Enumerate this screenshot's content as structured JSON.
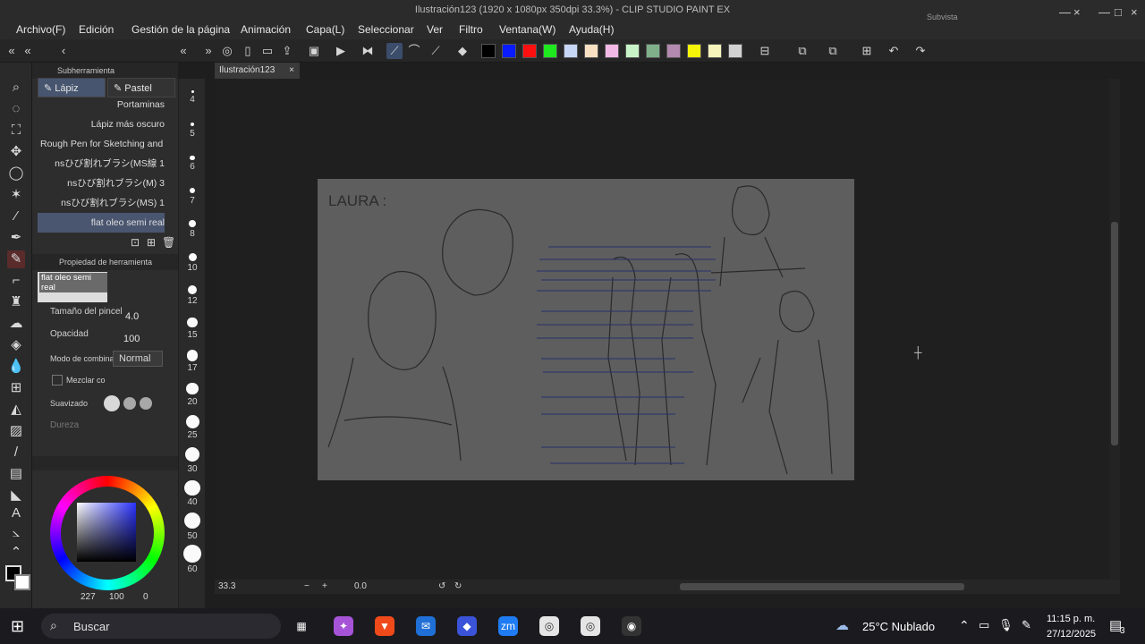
{
  "window": {
    "title": "Ilustración123 (1920 x 1080px 350dpi 33.3%)  - CLIP STUDIO PAINT EX",
    "subview_label": "Subvista"
  },
  "menu": [
    "Archivo(F)",
    "Edición",
    "Gestión de la página",
    "Animación",
    "Capa(L)",
    "Seleccionar",
    "Ver",
    "Filtro",
    "Ventana(W)",
    "Ayuda(H)"
  ],
  "toolbar": {
    "colors": [
      "#000000",
      "#0a1cff",
      "#ff1010",
      "#1ee81e",
      "#c8d6f5",
      "#f7e1c2",
      "#f3b9e6",
      "#c8f3c8",
      "#7fb089",
      "#b58ab0",
      "#f5f50a",
      "#f7f4bb",
      "#d2d2d2"
    ]
  },
  "subtool_panel": {
    "header": "Subherramienta",
    "tabs": [
      "Lápiz",
      "Pastel"
    ],
    "brushes": [
      "Portaminas",
      "Lápiz más oscuro",
      "Rough Pen for Sketching and",
      "nsひび割れブラシ(MS線 1",
      "nsひび割れブラシ(M) 3",
      "nsひび割れブラシ(MS) 1",
      "flat oleo semi real"
    ],
    "selected_brush_index": 6
  },
  "tool_property": {
    "header": "Propiedad de herramienta",
    "brush_name": "flat oleo semi real",
    "brush_size_label": "Tamaño del pincel",
    "brush_size_value": "4.0",
    "opacity_label": "Opacidad",
    "opacity_value": "100",
    "blend_label": "Modo de combinac",
    "blend_value": "Normal",
    "mix_label": "Mezclar co",
    "smoothing_label": "Suavizado",
    "hardness_label": "Dureza"
  },
  "brush_sizes": [
    "4",
    "5",
    "6",
    "7",
    "8",
    "10",
    "12",
    "15",
    "17",
    "20",
    "25",
    "30",
    "40",
    "50",
    "60"
  ],
  "color_panel": {
    "readout": [
      "227",
      "100",
      "0"
    ]
  },
  "document": {
    "tab_label": "Ilustración123",
    "canvas_title_sketch": "LAURA :"
  },
  "status": {
    "zoom": "33.3",
    "angle": "0.0"
  },
  "taskbar": {
    "search_label": "Buscar",
    "weather": "25°C  Nublado",
    "time": "11:15 p. m.",
    "date": "27/12/2025",
    "notification_count": "3"
  }
}
